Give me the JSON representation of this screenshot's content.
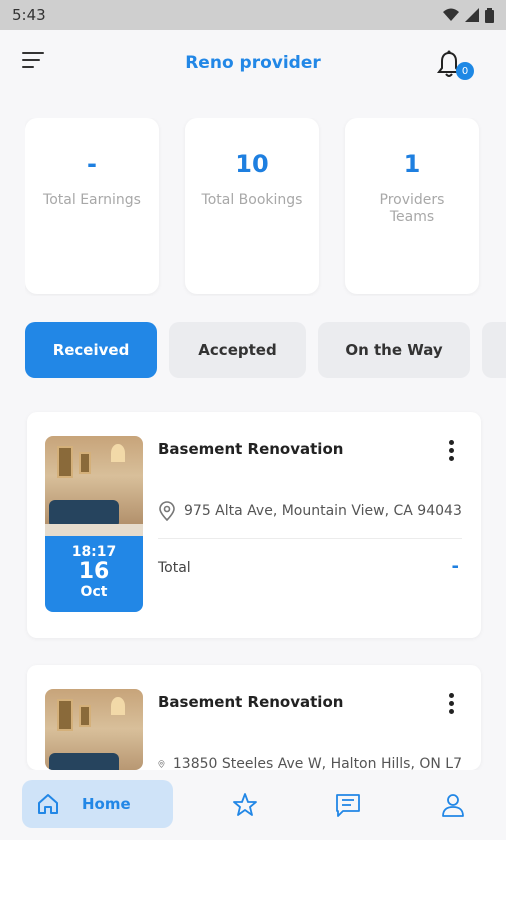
{
  "status_bar": {
    "time": "5:43"
  },
  "app_bar": {
    "title": "Reno provider",
    "notification_count": "0"
  },
  "stats": [
    {
      "value": "-",
      "label": "Total Earnings"
    },
    {
      "value": "10",
      "label": "Total Bookings"
    },
    {
      "value": "1",
      "label": "Providers Teams"
    }
  ],
  "tabs": [
    {
      "label": "Received",
      "active": true
    },
    {
      "label": "Accepted",
      "active": false
    },
    {
      "label": "On the Way",
      "active": false
    }
  ],
  "bookings": [
    {
      "title": "Basement Renovation",
      "address": "975 Alta Ave, Mountain View, CA 94043",
      "time": "18:17",
      "day": "16",
      "month": "Oct",
      "total_label": "Total",
      "total_value": "-"
    },
    {
      "title": "Basement Renovation",
      "address": "13850 Steeles Ave W, Halton Hills, ON L7",
      "time": "",
      "day": "",
      "month": "",
      "total_label": "",
      "total_value": ""
    }
  ],
  "bottom_nav": {
    "home_label": "Home"
  },
  "colors": {
    "accent": "#2287e6",
    "accent_light": "#cfe3f8",
    "background": "#f7f7f9"
  }
}
